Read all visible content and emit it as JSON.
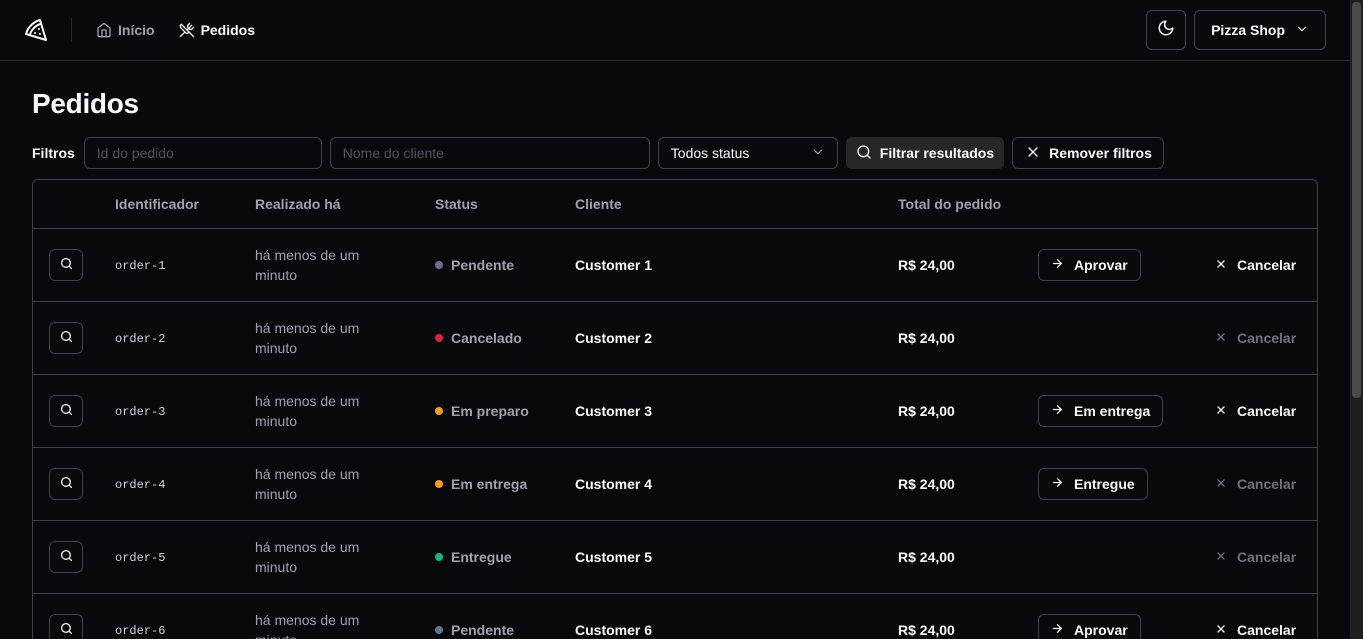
{
  "nav": {
    "items": [
      {
        "label": "Início",
        "icon": "home-icon",
        "active": false
      },
      {
        "label": "Pedidos",
        "icon": "utensils-crossed-icon",
        "active": true
      }
    ],
    "shop_name": "Pizza Shop"
  },
  "page": {
    "title": "Pedidos"
  },
  "filters": {
    "label": "Filtros",
    "order_id_placeholder": "Id do pedido",
    "customer_placeholder": "Nome do cliente",
    "status_value": "Todos status",
    "filter_button": "Filtrar resultados",
    "clear_button": "Remover filtros"
  },
  "table": {
    "headers": [
      "",
      "Identificador",
      "Realizado há",
      "Status",
      "Cliente",
      "Total do pedido",
      "",
      ""
    ],
    "rows": [
      {
        "id": "order-1",
        "time": "há menos de um minuto",
        "status": "Pendente",
        "status_color": "#64748b",
        "customer": "Customer 1",
        "total": "R$ 24,00",
        "action": "Aprovar",
        "cancel": "Cancelar",
        "cancel_enabled": true
      },
      {
        "id": "order-2",
        "time": "há menos de um minuto",
        "status": "Cancelado",
        "status_color": "#e11d48",
        "customer": "Customer 2",
        "total": "R$ 24,00",
        "action": "",
        "cancel": "Cancelar",
        "cancel_enabled": false
      },
      {
        "id": "order-3",
        "time": "há menos de um minuto",
        "status": "Em preparo",
        "status_color": "#f59e0b",
        "customer": "Customer 3",
        "total": "R$ 24,00",
        "action": "Em entrega",
        "cancel": "Cancelar",
        "cancel_enabled": true
      },
      {
        "id": "order-4",
        "time": "há menos de um minuto",
        "status": "Em entrega",
        "status_color": "#f59e0b",
        "customer": "Customer 4",
        "total": "R$ 24,00",
        "action": "Entregue",
        "cancel": "Cancelar",
        "cancel_enabled": false
      },
      {
        "id": "order-5",
        "time": "há menos de um minuto",
        "status": "Entregue",
        "status_color": "#10b981",
        "customer": "Customer 5",
        "total": "R$ 24,00",
        "action": "",
        "cancel": "Cancelar",
        "cancel_enabled": false
      },
      {
        "id": "order-6",
        "time": "há menos de um minuto",
        "status": "Pendente",
        "status_color": "#64748b",
        "customer": "Customer 6",
        "total": "R$ 24,00",
        "action": "Aprovar",
        "cancel": "Cancelar",
        "cancel_enabled": true
      }
    ]
  }
}
